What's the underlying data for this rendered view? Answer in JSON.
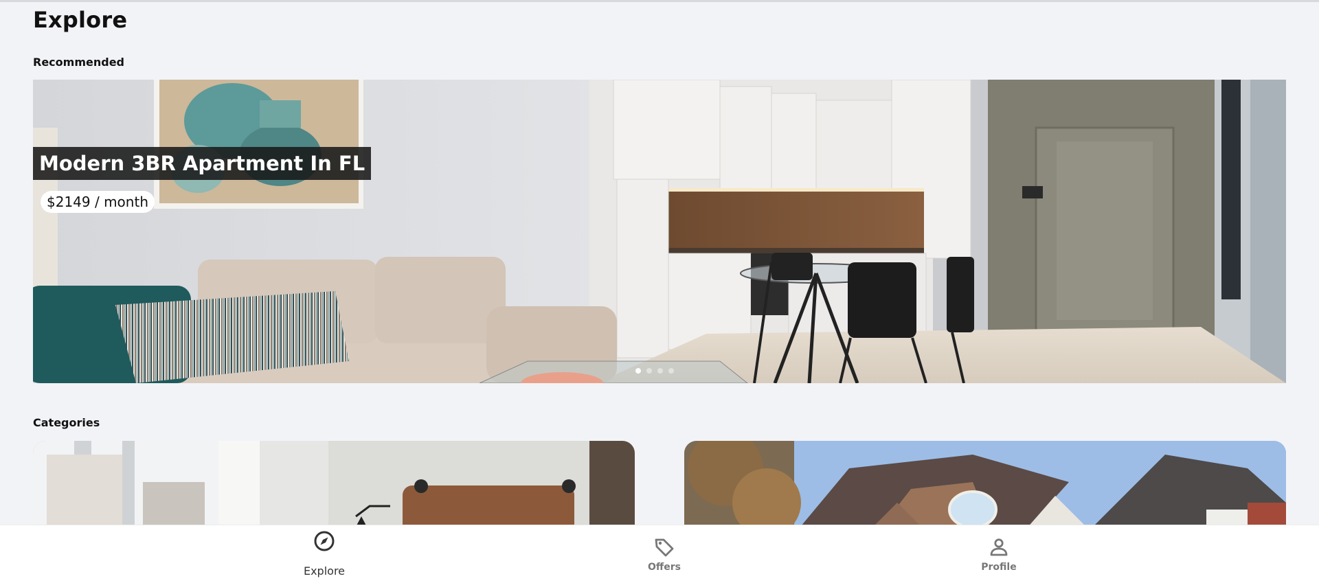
{
  "page": {
    "title": "Explore"
  },
  "sections": {
    "recommended": "Recommended",
    "categories": "Categories"
  },
  "carousel": {
    "active_index": 0,
    "slide_count": 4,
    "slides": [
      {
        "title": "Modern 3BR Apartment In FL",
        "price": "$2149 / month"
      }
    ]
  },
  "bottom_nav": {
    "active": "explore",
    "items": [
      {
        "id": "explore",
        "label": "Explore",
        "icon": "compass-icon"
      },
      {
        "id": "offers",
        "label": "Offers",
        "icon": "tag-icon"
      },
      {
        "id": "profile",
        "label": "Profile",
        "icon": "person-icon"
      }
    ]
  },
  "colors": {
    "background": "#f2f3f7",
    "nav_active": "#333333",
    "nav_inactive": "#777777",
    "title_overlay": "#191919"
  }
}
